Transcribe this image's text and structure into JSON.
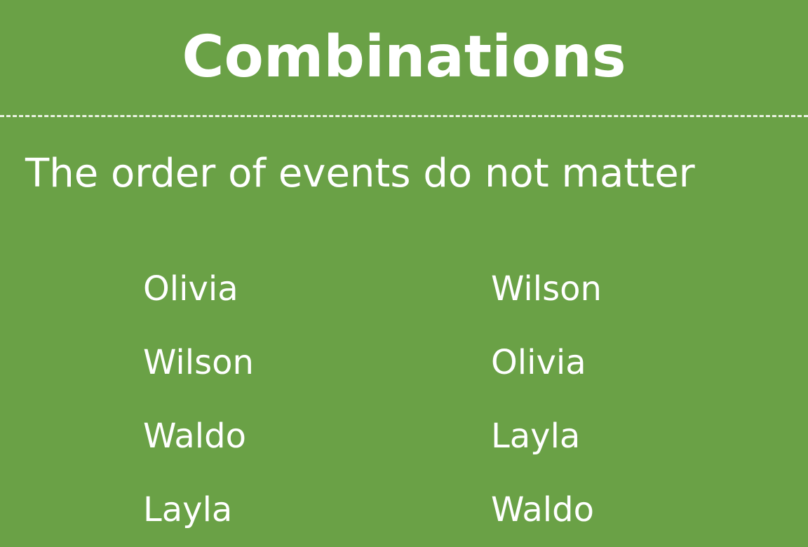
{
  "slide": {
    "title": "Combinations",
    "subtitle": "The order of events do not matter",
    "background_color": "#6aa146",
    "text_color": "#ffffff",
    "left_column": [
      "Olivia",
      "Wilson",
      "Waldo",
      "Layla"
    ],
    "right_column": [
      "Wilson",
      "Olivia",
      "Layla",
      "Waldo"
    ]
  }
}
